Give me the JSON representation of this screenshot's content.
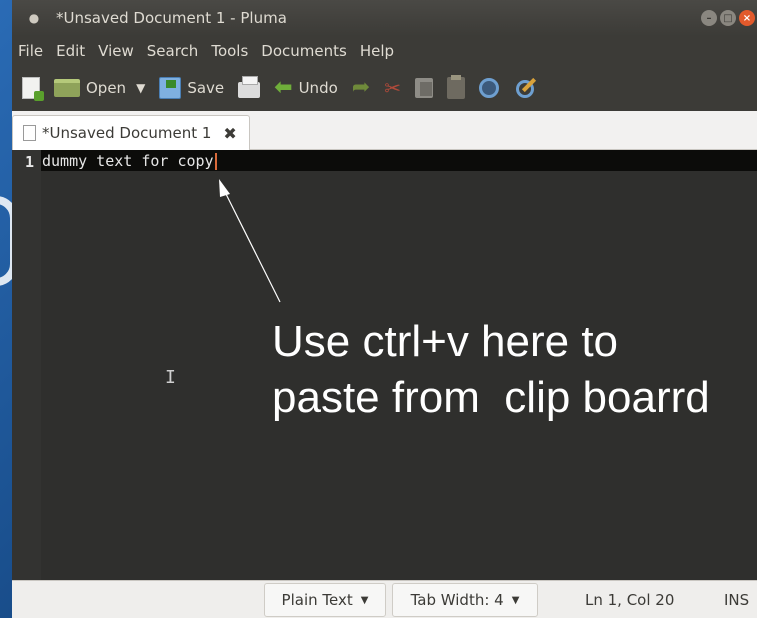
{
  "window": {
    "title": "*Unsaved Document 1 - Pluma"
  },
  "menubar": {
    "items": [
      "File",
      "Edit",
      "View",
      "Search",
      "Tools",
      "Documents",
      "Help"
    ]
  },
  "toolbar": {
    "open_label": "Open",
    "save_label": "Save",
    "undo_label": "Undo"
  },
  "tabs": [
    {
      "label": "*Unsaved Document 1"
    }
  ],
  "editor": {
    "line_number": "1",
    "line_text": "dummy text for copy"
  },
  "annotation": {
    "text": "Use ctrl+v here to\npaste from  clip boarrd"
  },
  "statusbar": {
    "language": "Plain Text",
    "tab_width": "Tab Width: 4",
    "position": "Ln 1, Col 20",
    "mode": "INS"
  },
  "colors": {
    "annotation_text": "#ffffff",
    "editor_bg": "#2f2f2d",
    "current_line_bg": "#0c0c0a"
  }
}
